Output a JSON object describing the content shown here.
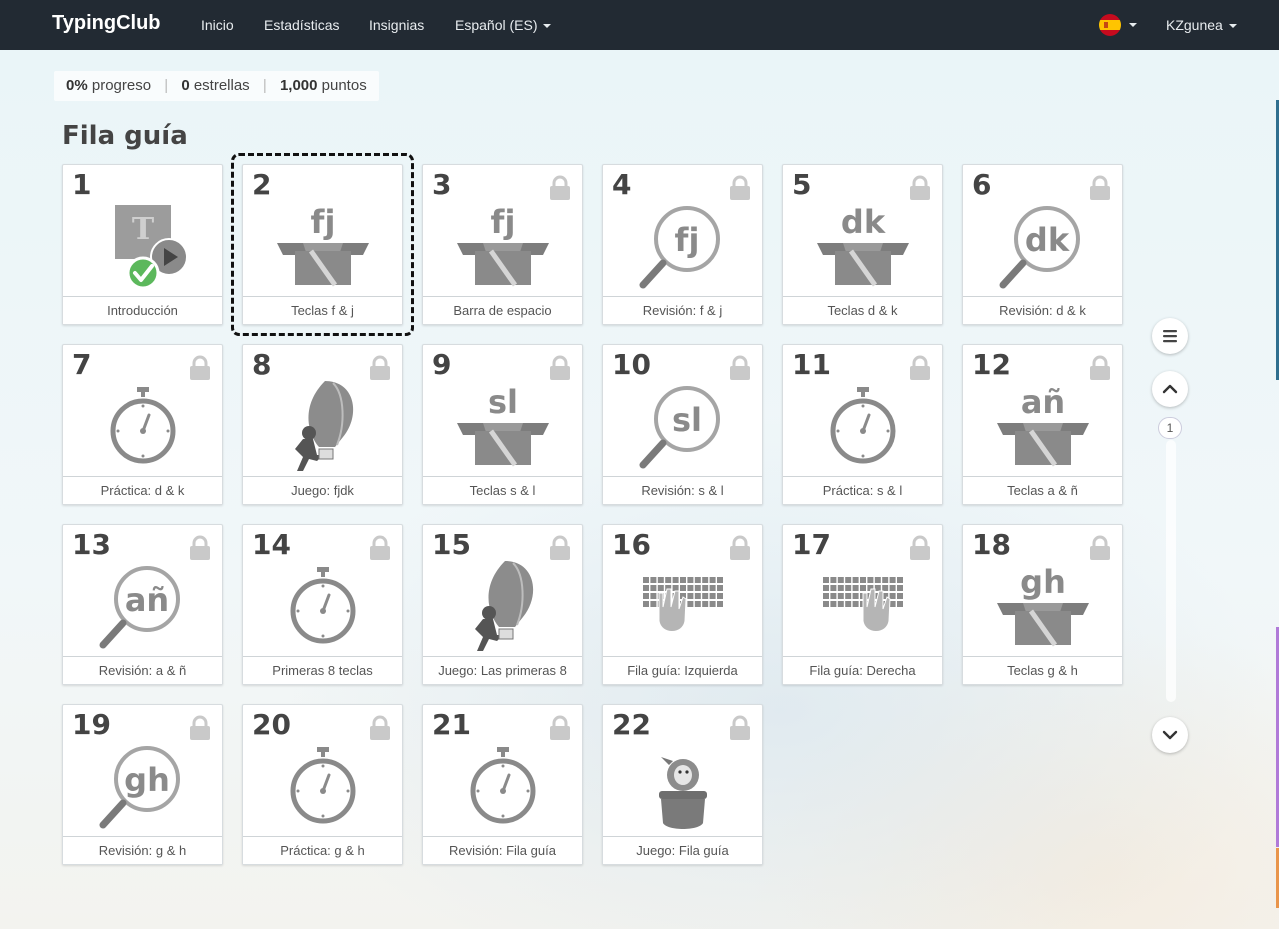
{
  "nav": {
    "brand": "TypingClub",
    "links": [
      "Inicio",
      "Estadísticas",
      "Insignias"
    ],
    "language": "Español (ES)",
    "user": "KZgunea"
  },
  "stats": {
    "progress_value": "0%",
    "progress_label": "progreso",
    "stars_value": "0",
    "stars_label": "estrellas",
    "points_value": "1,000",
    "points_label": "puntos"
  },
  "section_title": "Fila guía",
  "pager": {
    "page": "1"
  },
  "lessons": [
    {
      "num": "1",
      "label": "Introducción",
      "icon": "intro-video-icon",
      "locked": false,
      "completed": true
    },
    {
      "num": "2",
      "label": "Teclas f & j",
      "icon": "box-icon",
      "keys": "fj",
      "locked": false,
      "selected": true
    },
    {
      "num": "3",
      "label": "Barra de espacio",
      "icon": "box-icon",
      "keys": "fj",
      "locked": true
    },
    {
      "num": "4",
      "label": "Revisión: f & j",
      "icon": "magnifier-icon",
      "keys": "fj",
      "locked": true
    },
    {
      "num": "5",
      "label": "Teclas d & k",
      "icon": "box-icon",
      "keys": "dk",
      "locked": true
    },
    {
      "num": "6",
      "label": "Revisión: d & k",
      "icon": "magnifier-icon",
      "keys": "dk",
      "locked": true
    },
    {
      "num": "7",
      "label": "Práctica: d & k",
      "icon": "stopwatch-icon",
      "locked": true
    },
    {
      "num": "8",
      "label": "Juego: fjdk",
      "icon": "balloon-game-icon",
      "locked": true
    },
    {
      "num": "9",
      "label": "Teclas s & l",
      "icon": "box-icon",
      "keys": "sl",
      "locked": true
    },
    {
      "num": "10",
      "label": "Revisión: s & l",
      "icon": "magnifier-icon",
      "keys": "sl",
      "locked": true
    },
    {
      "num": "11",
      "label": "Práctica: s & l",
      "icon": "stopwatch-icon",
      "locked": true
    },
    {
      "num": "12",
      "label": "Teclas a & ñ",
      "icon": "box-icon",
      "keys": "añ",
      "locked": true
    },
    {
      "num": "13",
      "label": "Revisión: a & ñ",
      "icon": "magnifier-icon",
      "keys": "añ",
      "locked": true
    },
    {
      "num": "14",
      "label": "Primeras 8 teclas",
      "icon": "stopwatch-icon",
      "locked": true
    },
    {
      "num": "15",
      "label": "Juego: Las primeras 8",
      "icon": "balloon-game-icon",
      "locked": true
    },
    {
      "num": "16",
      "label": "Fila guía: Izquierda",
      "icon": "keyboard-left-hand-icon",
      "locked": true
    },
    {
      "num": "17",
      "label": "Fila guía: Derecha",
      "icon": "keyboard-right-hand-icon",
      "locked": true
    },
    {
      "num": "18",
      "label": "Teclas g & h",
      "icon": "box-icon",
      "keys": "gh",
      "locked": true
    },
    {
      "num": "19",
      "label": "Revisión: g & h",
      "icon": "magnifier-icon",
      "keys": "gh",
      "locked": true
    },
    {
      "num": "20",
      "label": "Práctica: g & h",
      "icon": "stopwatch-icon",
      "locked": true
    },
    {
      "num": "21",
      "label": "Revisión: Fila guía",
      "icon": "stopwatch-icon",
      "locked": true
    },
    {
      "num": "22",
      "label": "Juego: Fila guía",
      "icon": "pot-creature-game-icon",
      "locked": true
    }
  ],
  "colors": {
    "navbar": "#222a33",
    "icon_gray": "#8a8a8a",
    "check_green": "#5cb85c",
    "edge_blue": "#2f6f8f",
    "edge_purple": "#b07ad8",
    "edge_orange": "#e9954b"
  }
}
